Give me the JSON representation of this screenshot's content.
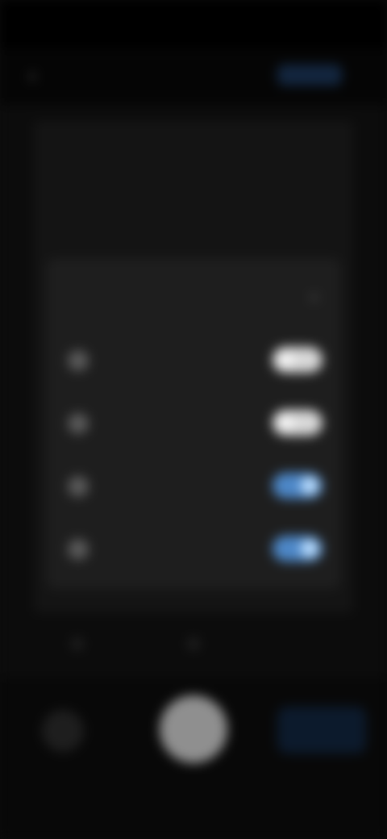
{
  "status_bar": {
    "time": "",
    "icons": ""
  },
  "top_bar": {
    "action_label": ""
  },
  "settings_sheet": {
    "title": "",
    "rows": [
      {
        "label": "",
        "enabled": false
      },
      {
        "label": "",
        "enabled": false
      },
      {
        "label": "",
        "enabled": true
      },
      {
        "label": "",
        "enabled": true
      }
    ]
  },
  "bottom_bar": {
    "tabs": [
      "",
      "",
      ""
    ]
  },
  "colors": {
    "toggle_on": "#4d87c7",
    "toggle_off": "#d8d8d8",
    "accent": "#13263f"
  }
}
